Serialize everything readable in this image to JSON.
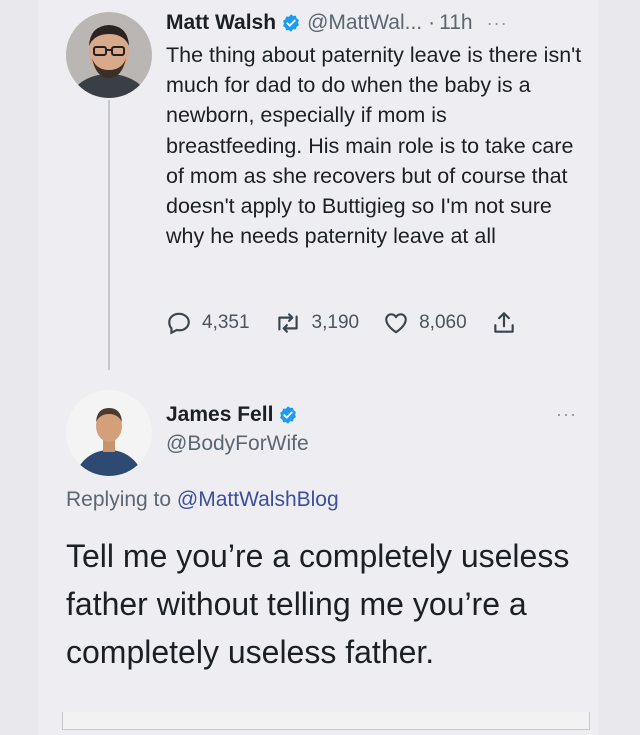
{
  "tweet1": {
    "name": "Matt Walsh",
    "handle": "@MattWal...",
    "time": "11h",
    "more": "···",
    "text": "The thing about paternity leave is there isn't much for dad to do when the baby is a newborn, especially if mom is breastfeeding. His main role is to take care of mom as she recovers but of course that doesn't apply to Buttigieg so I'm not sure why he needs paternity leave at all",
    "replies": "4,351",
    "retweets": "3,190",
    "likes": "8,060",
    "verified": true
  },
  "tweet2": {
    "name": "James Fell",
    "handle": "@BodyForWife",
    "more": "···",
    "replying_prefix": "Replying to ",
    "replying_handle": "@MattWalshBlog",
    "text": "Tell me you’re a completely useless father without telling me you’re a completely useless father.",
    "verified": true
  },
  "colors": {
    "verified": "#1d9bf0",
    "link": "#3b4f9e",
    "muted": "#5c6670"
  },
  "icons": [
    "verified-badge-icon",
    "reply-icon",
    "retweet-icon",
    "like-icon",
    "share-icon",
    "more-icon"
  ]
}
